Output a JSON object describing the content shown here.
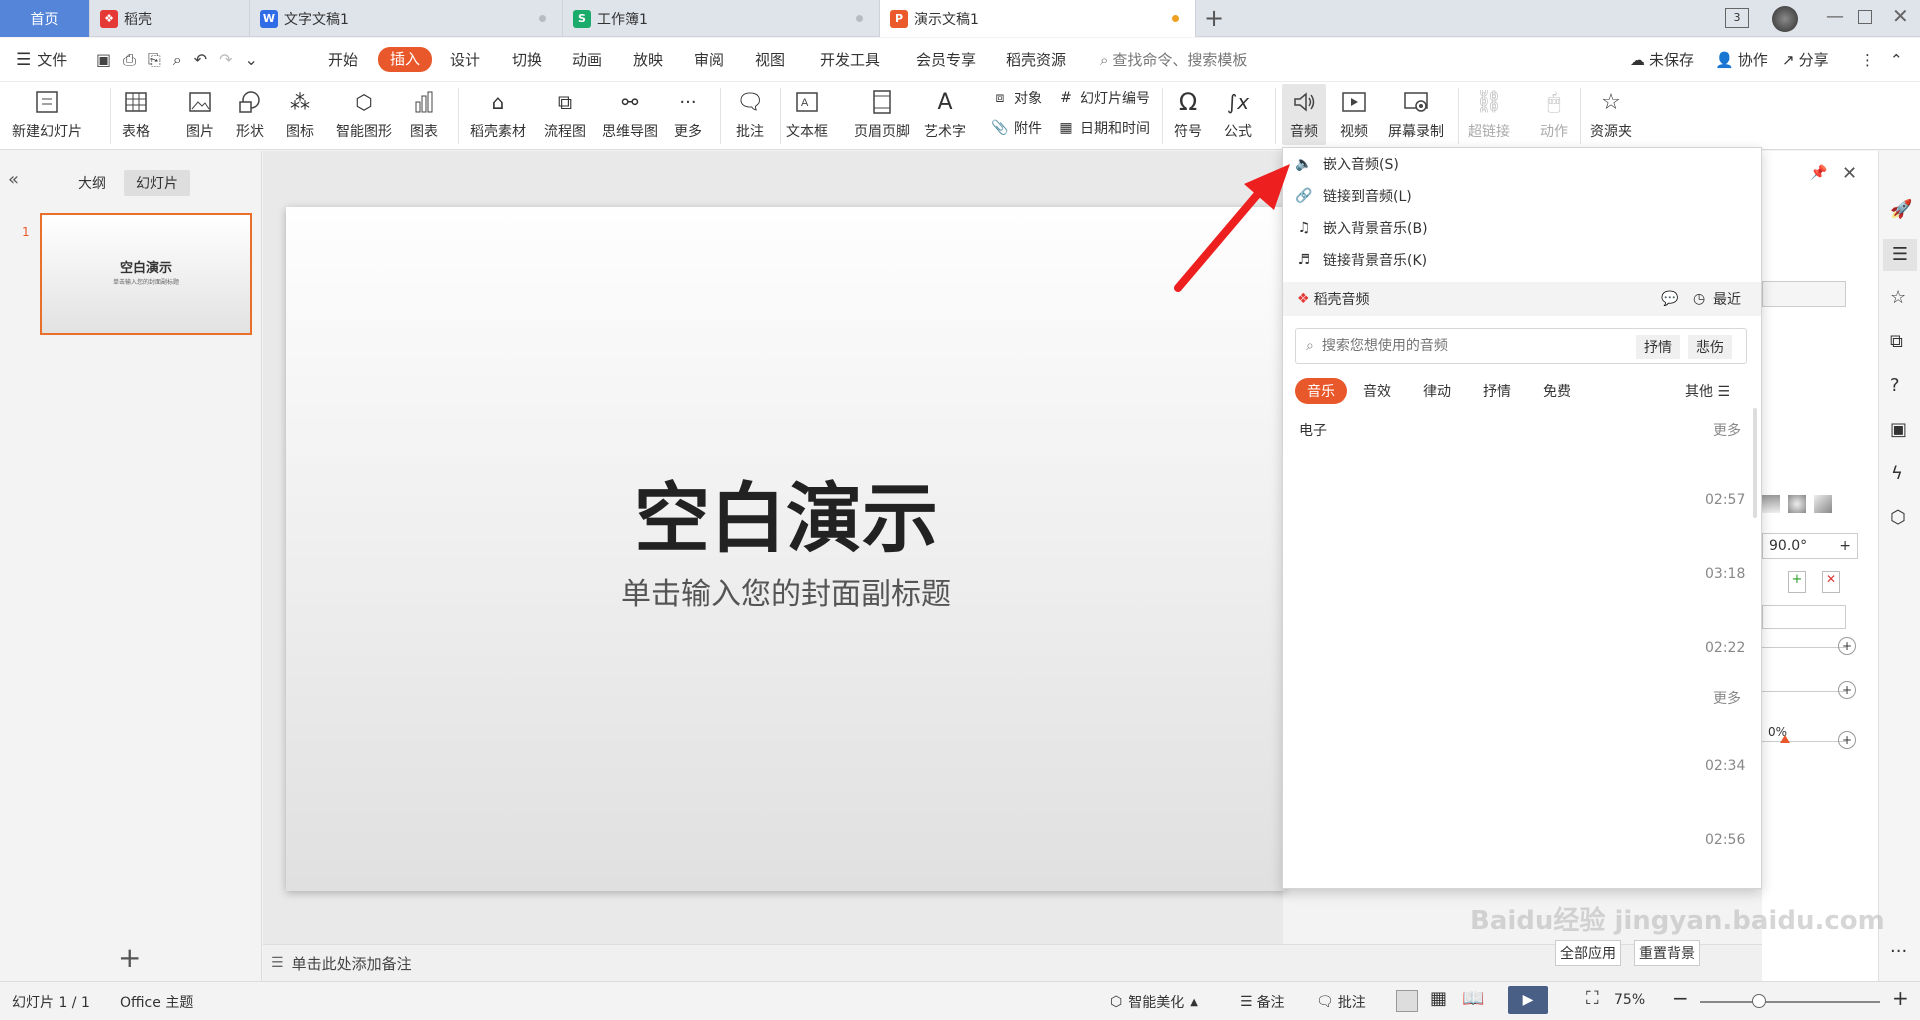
{
  "tabs": [
    {
      "label": "首页"
    },
    {
      "label": "稻壳"
    },
    {
      "label": "文字文稿1"
    },
    {
      "label": "工作簿1"
    },
    {
      "label": "演示文稿1"
    }
  ],
  "menu": {
    "file": "文件",
    "items": [
      "开始",
      "插入",
      "设计",
      "切换",
      "动画",
      "放映",
      "审阅",
      "视图",
      "开发工具",
      "会员专享",
      "稻壳资源"
    ],
    "search_placeholder": "查找命令、搜索模板",
    "unsaved": "未保存",
    "collab": "协作",
    "share": "分享"
  },
  "ribbon": {
    "new_slide": "新建幻灯片",
    "table": "表格",
    "picture": "图片",
    "shape": "形状",
    "icon": "图标",
    "smart_shape": "智能图形",
    "chart": "图表",
    "daoke_material": "稻壳素材",
    "flowchart": "流程图",
    "mindmap": "思维导图",
    "more": "更多",
    "comment": "批注",
    "textbox": "文本框",
    "header_footer": "页眉页脚",
    "wordart": "艺术字",
    "object": "对象",
    "attachment": "附件",
    "slide_number": "幻灯片编号",
    "datetime": "日期和时间",
    "symbol": "符号",
    "formula": "公式",
    "audio": "音频",
    "video": "视频",
    "screen_record": "屏幕录制",
    "hyperlink": "超链接",
    "action": "动作",
    "resources": "资源夹"
  },
  "left_pane": {
    "outline_tab": "大纲",
    "slides_tab": "幻灯片",
    "slide_index": "1",
    "thumb_title": "空白演示",
    "thumb_sub": "单击输入您的封面副标题"
  },
  "slide": {
    "title": "空白演示",
    "subtitle": "单击输入您的封面副标题"
  },
  "notes_placeholder": "单击此处添加备注",
  "audio_menu": {
    "items": [
      {
        "label": "嵌入音频(S)"
      },
      {
        "label": "链接到音频(L)"
      },
      {
        "label": "嵌入背景音乐(B)"
      },
      {
        "label": "链接背景音乐(K)"
      }
    ],
    "daoke_audio": "稻壳音频",
    "recent": "最近",
    "search_placeholder": "搜索您想使用的音频",
    "quick_tags": [
      "抒情",
      "悲伤"
    ],
    "categories": [
      "音乐",
      "音效",
      "律动",
      "抒情",
      "免费"
    ],
    "others": "其他",
    "section1_title": "电子",
    "more": "更多",
    "durations1": [
      "02:57",
      "03:18",
      "02:22"
    ],
    "durations2": [
      "02:34",
      "02:56"
    ]
  },
  "right_pane": {
    "angle": "90.0°",
    "percent": "0%",
    "apply_all": "全部应用",
    "reset_bg": "重置背景"
  },
  "status": {
    "slide_count": "幻灯片 1 / 1",
    "theme": "Office 主题",
    "beautify": "智能美化",
    "notes": "备注",
    "comments": "批注",
    "zoom": "75%"
  },
  "watermark": "Baidu经验 jingyan.baidu.com",
  "colors": {
    "accent": "#e9582a",
    "wps_blue": "#5585d9",
    "arrow_red": "#ee1f1f"
  }
}
